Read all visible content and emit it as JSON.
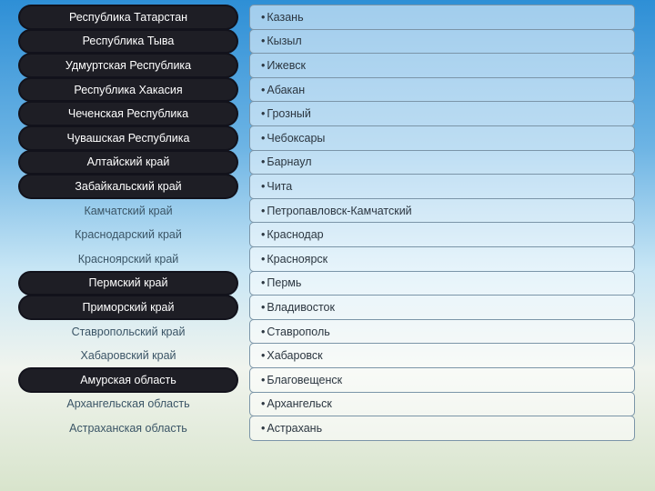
{
  "rows": [
    {
      "region": "Республика Татарстан",
      "city": "Казань",
      "filled": true
    },
    {
      "region": "Республика Тыва",
      "city": "Кызыл",
      "filled": true
    },
    {
      "region": "Удмуртская Республика",
      "city": "Ижевск",
      "filled": true
    },
    {
      "region": "Республика Хакасия",
      "city": "Абакан",
      "filled": true
    },
    {
      "region": "Чеченская Республика",
      "city": "Грозный",
      "filled": true
    },
    {
      "region": "Чувашская Республика",
      "city": "Чебоксары",
      "filled": true
    },
    {
      "region": "Алтайский край",
      "city": "Барнаул",
      "filled": true
    },
    {
      "region": "Забайкальский край",
      "city": "Чита",
      "filled": true
    },
    {
      "region": "Камчатский край",
      "city": "Петропавловск-Камчатский",
      "filled": false
    },
    {
      "region": "Краснодарский край",
      "city": "Краснодар",
      "filled": false
    },
    {
      "region": "Красноярский край",
      "city": "Красноярск",
      "filled": false
    },
    {
      "region": "Пермский край",
      "city": "Пермь",
      "filled": true
    },
    {
      "region": "Приморский край",
      "city": "Владивосток",
      "filled": true
    },
    {
      "region": "Ставропольский край",
      "city": "Ставрополь",
      "filled": false
    },
    {
      "region": "Хабаровский край",
      "city": "Хабаровск",
      "filled": false
    },
    {
      "region": "Амурская область",
      "city": "Благовещенск",
      "filled": true
    },
    {
      "region": "Архангельская область",
      "city": "Архангельск",
      "filled": false
    },
    {
      "region": "Астраханская область",
      "city": "Астрахань",
      "filled": false
    }
  ]
}
